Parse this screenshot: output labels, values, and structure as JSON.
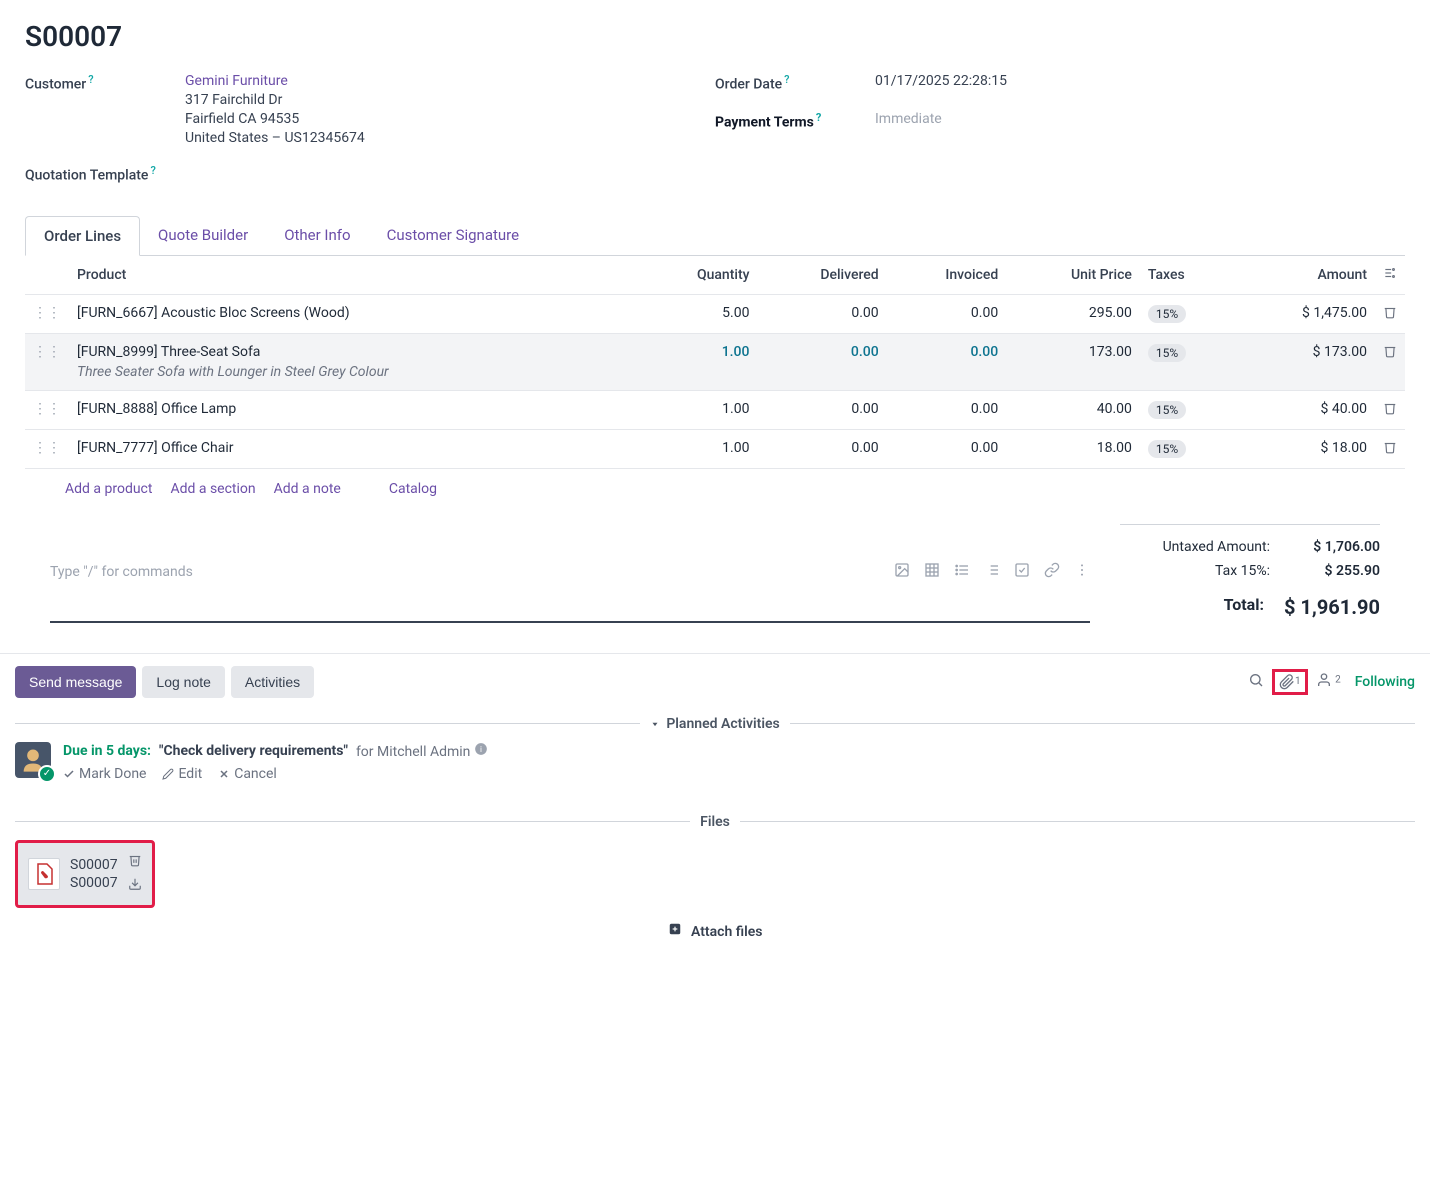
{
  "order": {
    "title": "S00007",
    "customer_label": "Customer",
    "customer_name": "Gemini Furniture",
    "address_line1": "317 Fairchild Dr",
    "address_line2": "Fairfield CA 94535",
    "address_line3": "United States – US12345674",
    "quotation_template_label": "Quotation Template",
    "order_date_label": "Order Date",
    "order_date_value": "01/17/2025 22:28:15",
    "payment_terms_label": "Payment Terms",
    "payment_terms_placeholder": "Immediate"
  },
  "tabs": [
    {
      "label": "Order Lines"
    },
    {
      "label": "Quote Builder"
    },
    {
      "label": "Other Info"
    },
    {
      "label": "Customer Signature"
    }
  ],
  "table": {
    "headers": {
      "product": "Product",
      "quantity": "Quantity",
      "delivered": "Delivered",
      "invoiced": "Invoiced",
      "unit_price": "Unit Price",
      "taxes": "Taxes",
      "amount": "Amount"
    },
    "rows": [
      {
        "product": "[FURN_6667] Acoustic Bloc Screens (Wood)",
        "desc": "",
        "qty": "5.00",
        "delivered": "0.00",
        "invoiced": "0.00",
        "price": "295.00",
        "tax": "15%",
        "amount": "$ 1,475.00",
        "selected": false
      },
      {
        "product": "[FURN_8999] Three-Seat Sofa",
        "desc": "Three Seater Sofa with Lounger in Steel Grey Colour",
        "qty": "1.00",
        "delivered": "0.00",
        "invoiced": "0.00",
        "price": "173.00",
        "tax": "15%",
        "amount": "$ 173.00",
        "selected": true
      },
      {
        "product": "[FURN_8888] Office Lamp",
        "desc": "",
        "qty": "1.00",
        "delivered": "0.00",
        "invoiced": "0.00",
        "price": "40.00",
        "tax": "15%",
        "amount": "$ 40.00",
        "selected": false
      },
      {
        "product": "[FURN_7777] Office Chair",
        "desc": "",
        "qty": "1.00",
        "delivered": "0.00",
        "invoiced": "0.00",
        "price": "18.00",
        "tax": "15%",
        "amount": "$ 18.00",
        "selected": false
      }
    ],
    "add_product": "Add a product",
    "add_section": "Add a section",
    "add_note": "Add a note",
    "catalog": "Catalog"
  },
  "notes_placeholder": "Type \"/\" for commands",
  "totals": {
    "untaxed_label": "Untaxed Amount:",
    "untaxed_value": "$ 1,706.00",
    "tax_label": "Tax 15%:",
    "tax_value": "$ 255.90",
    "total_label": "Total:",
    "total_value": "$ 1,961.90"
  },
  "chatter": {
    "send_message": "Send message",
    "log_note": "Log note",
    "activities": "Activities",
    "attach_count": "1",
    "follower_count": "2",
    "following": "Following"
  },
  "planned_activities_label": "Planned Activities",
  "activity": {
    "due": "Due in 5 days:",
    "title": "\"Check delivery requirements\"",
    "for": "for Mitchell Admin",
    "mark_done": "Mark Done",
    "edit": "Edit",
    "cancel": "Cancel"
  },
  "files_label": "Files",
  "file": {
    "name1": "S00007",
    "name2": "S00007"
  },
  "attach_files_label": "Attach files"
}
